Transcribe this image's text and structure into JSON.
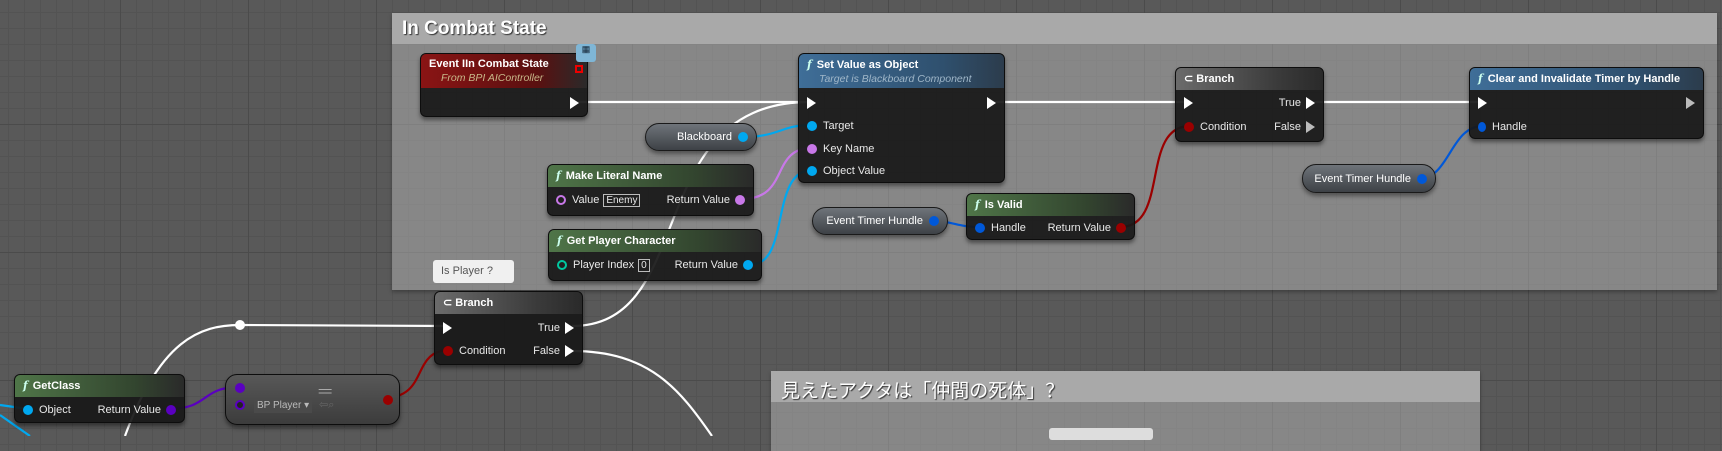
{
  "comments": {
    "combat": "In Combat State",
    "corpse": "見えたアクタは「仲間の死体」？"
  },
  "bubble": {
    "is_player": "Is Player ?"
  },
  "event_node": {
    "title": "Event IIn Combat State",
    "subtitle": "From BPI AIController"
  },
  "set_value": {
    "title": "Set Value as Object",
    "subtitle": "Target is Blackboard Component",
    "pins": [
      "Target",
      "Key Name",
      "Object Value"
    ]
  },
  "blackboard_var": "Blackboard",
  "make_literal": {
    "title": "Make Literal Name",
    "in": "Value",
    "value": "Enemy",
    "out": "Return Value"
  },
  "get_player": {
    "title": "Get Player Character",
    "in": "Player Index",
    "value": "0",
    "out": "Return Value"
  },
  "branch1": {
    "title": "Branch",
    "exec_true": "True",
    "condition": "Condition",
    "exec_false": "False"
  },
  "branch2": {
    "title": "Branch",
    "exec_true": "True",
    "condition": "Condition",
    "exec_false": "False"
  },
  "timer_var_1": "Event Timer Hundle",
  "timer_var_2": "Event Timer Hundle",
  "is_valid": {
    "title": "Is Valid",
    "in": "Handle",
    "out": "Return Value"
  },
  "clear_timer": {
    "title": "Clear and Invalidate Timer by Handle",
    "in": "Handle"
  },
  "get_class": {
    "title": "GetClass",
    "in": "Object",
    "out": "Return Value"
  },
  "equal_node": {
    "class_value": "BP Player"
  },
  "colors": {
    "exec": "#ffffff",
    "object": "#00a8f0",
    "name": "#c878e8",
    "bool": "#9a0000",
    "struct": "#0058d8",
    "class": "#5a00c0"
  }
}
